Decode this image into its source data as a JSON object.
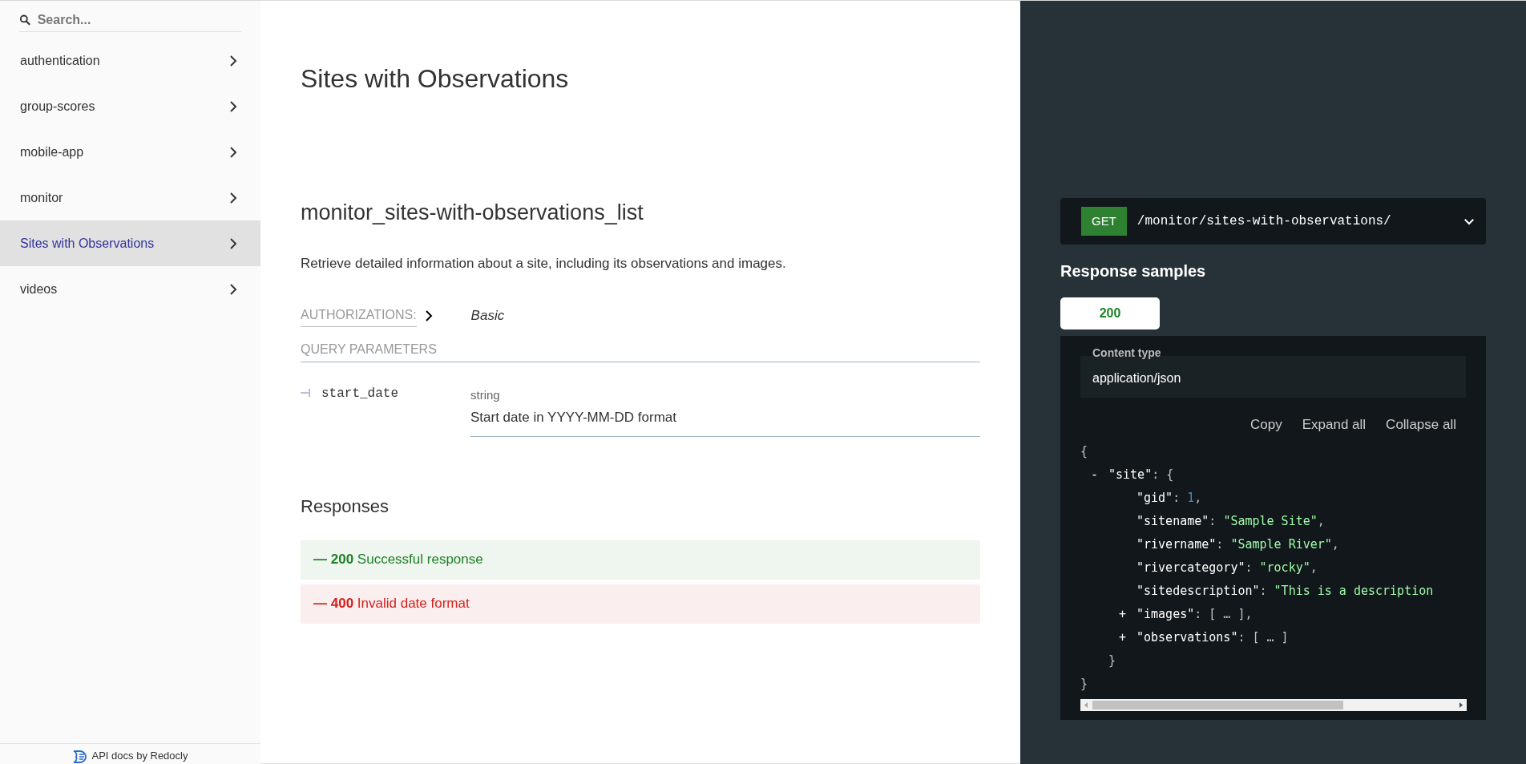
{
  "sidebar": {
    "search": {
      "placeholder": "Search..."
    },
    "items": [
      {
        "label": "authentication",
        "selected": false
      },
      {
        "label": "group-scores",
        "selected": false
      },
      {
        "label": "mobile-app",
        "selected": false
      },
      {
        "label": "monitor",
        "selected": false
      },
      {
        "label": "Sites with Observations",
        "selected": true
      },
      {
        "label": "videos",
        "selected": false
      }
    ],
    "footer": "API docs by Redocly"
  },
  "main": {
    "title": "Sites with Observations",
    "operation": "monitor_sites-with-observations_list",
    "description": "Retrieve detailed information about a site, including its observations and images.",
    "authorizations": {
      "label": "AUTHORIZATIONS:",
      "value": "Basic"
    },
    "query_parameters": {
      "heading": "QUERY PARAMETERS",
      "params": [
        {
          "name": "start_date",
          "type": "string",
          "description": "Start date in YYYY-MM-DD format"
        }
      ]
    },
    "responses": {
      "heading": "Responses",
      "items": [
        {
          "kind": "success",
          "dash": "—",
          "code": "200",
          "text": "Successful response"
        },
        {
          "kind": "error",
          "dash": "—",
          "code": "400",
          "text": "Invalid date format"
        }
      ]
    }
  },
  "panel": {
    "endpoint": {
      "method": "GET",
      "path": "/monitor/sites-with-observations/"
    },
    "heading": "Response samples",
    "tabs": [
      {
        "label": "200",
        "selected": true
      }
    ],
    "content_type": {
      "label": "Content type",
      "value": "application/json"
    },
    "actions": [
      "Copy",
      "Expand all",
      "Collapse all"
    ],
    "sample": {
      "tokens": [
        {
          "kind": "punct",
          "text": "{"
        }
      ],
      "close": [
        {
          "kind": "punct",
          "text": "}"
        }
      ],
      "children": [
        {
          "toggle": "-",
          "tokens": [
            {
              "kind": "key",
              "text": "\"site\""
            },
            {
              "kind": "punct",
              "text": ": {"
            }
          ],
          "close": [
            {
              "kind": "punct",
              "text": "}"
            }
          ],
          "children": [
            {
              "tokens": [
                {
                  "kind": "key",
                  "text": "\"gid\""
                },
                {
                  "kind": "punct",
                  "text": ": "
                },
                {
                  "kind": "number",
                  "text": "1"
                },
                {
                  "kind": "punct",
                  "text": ","
                }
              ]
            },
            {
              "tokens": [
                {
                  "kind": "key",
                  "text": "\"sitename\""
                },
                {
                  "kind": "punct",
                  "text": ": "
                },
                {
                  "kind": "string",
                  "text": "\"Sample Site\""
                },
                {
                  "kind": "punct",
                  "text": ","
                }
              ]
            },
            {
              "tokens": [
                {
                  "kind": "key",
                  "text": "\"rivername\""
                },
                {
                  "kind": "punct",
                  "text": ": "
                },
                {
                  "kind": "string",
                  "text": "\"Sample River\""
                },
                {
                  "kind": "punct",
                  "text": ","
                }
              ]
            },
            {
              "tokens": [
                {
                  "kind": "key",
                  "text": "\"rivercategory\""
                },
                {
                  "kind": "punct",
                  "text": ": "
                },
                {
                  "kind": "string",
                  "text": "\"rocky\""
                },
                {
                  "kind": "punct",
                  "text": ","
                }
              ]
            },
            {
              "tokens": [
                {
                  "kind": "key",
                  "text": "\"sitedescription\""
                },
                {
                  "kind": "punct",
                  "text": ": "
                },
                {
                  "kind": "string",
                  "text": "\"This is a description"
                }
              ]
            },
            {
              "toggle": "+",
              "tokens": [
                {
                  "kind": "key",
                  "text": "\"images\""
                },
                {
                  "kind": "punct",
                  "text": ": [ … ],"
                }
              ]
            },
            {
              "toggle": "+",
              "tokens": [
                {
                  "kind": "key",
                  "text": "\"observations\""
                },
                {
                  "kind": "punct",
                  "text": ": [ … ]"
                }
              ]
            }
          ]
        }
      ]
    }
  }
}
